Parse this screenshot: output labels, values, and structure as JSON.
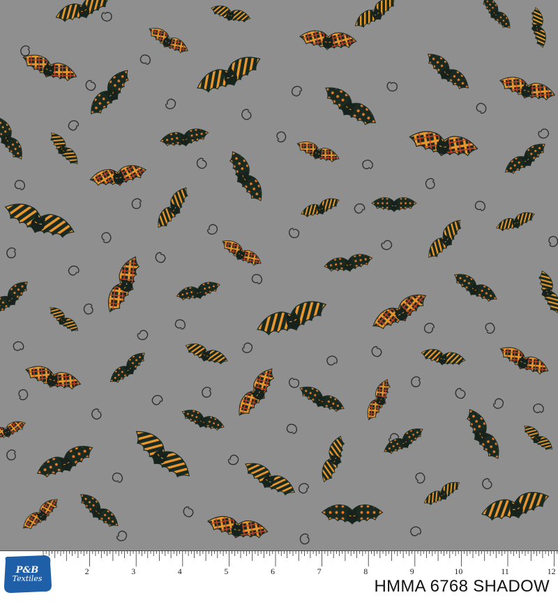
{
  "logo": {
    "brand": "P&B",
    "sub": "Textiles"
  },
  "product_code": "HMMA 6768 SHADOW",
  "ruler": {
    "numbers": [
      "2",
      "3",
      "4",
      "5",
      "6",
      "7",
      "8",
      "9",
      "10",
      "11",
      "12"
    ]
  },
  "colors": {
    "background": "#8f8f8f",
    "bat_black": "#1b2a20",
    "stripe_orange": "#e8962e",
    "dot_orange": "#e07a2a",
    "plaid_red": "#c4442a",
    "swirl": "#2f2f2f",
    "logo_blue": "#1f5fa8"
  }
}
